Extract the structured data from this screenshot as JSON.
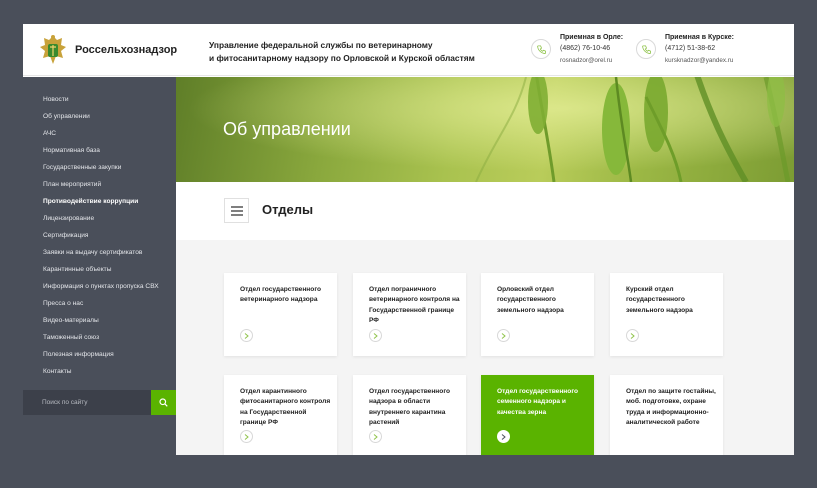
{
  "header": {
    "site_name": "Россельхознадзор",
    "org_title_line1": "Управление федеральной службы по ветеринарному",
    "org_title_line2": "и фитосанитарному надзору по Орловской и Курской областям",
    "contacts": [
      {
        "title": "Приемная в Орле:",
        "phone": "(4862) 76-10-46",
        "email": "rosnadzor@orel.ru"
      },
      {
        "title": "Приемная в Курске:",
        "phone": "(4712) 51-38-62",
        "email": "kursknadzor@yandex.ru"
      }
    ]
  },
  "sidebar": {
    "items": [
      {
        "label": "Новости"
      },
      {
        "label": "Об управлении"
      },
      {
        "label": "АЧС"
      },
      {
        "label": "Нормативная база"
      },
      {
        "label": "Государственные закупки"
      },
      {
        "label": "План мероприятий"
      },
      {
        "label": "Противодействие коррупции"
      },
      {
        "label": "Лицензирование"
      },
      {
        "label": "Сертификация"
      },
      {
        "label": "Заявки на выдачу сертификатов"
      },
      {
        "label": "Карантинные объекты"
      },
      {
        "label": "Информация о пунктах пропуска СВХ"
      },
      {
        "label": "Пресса о нас"
      },
      {
        "label": "Видео-материалы"
      },
      {
        "label": "Таможенный союз"
      },
      {
        "label": "Полезная информация"
      },
      {
        "label": "Контакты"
      }
    ],
    "active_index": 6,
    "search_placeholder": "Поиск по сайту"
  },
  "hero": {
    "title": "Об управлении"
  },
  "section": {
    "title": "Отделы"
  },
  "cards": [
    {
      "title": "Отдел государственного ветеринарного надзора"
    },
    {
      "title": "Отдел пограничного ветеринарного контроля на Государственной границе РФ"
    },
    {
      "title": "Орловский отдел государственного земельного надзора"
    },
    {
      "title": "Курский отдел государственного земельного надзора"
    },
    {
      "title": "Отдел карантинного фитосанитарного контроля на Государственной границе РФ"
    },
    {
      "title": "Отдел государственного надзора в области внутреннего карантина растений"
    },
    {
      "title": "Отдел государственного семенного надзора и качества зерна"
    },
    {
      "title": "Отдел по защите гостайны, моб. подготовке, охране труда и информационно-аналитической работе"
    }
  ],
  "colors": {
    "accent": "#5ab300",
    "sidebar": "#4a4f5a"
  },
  "icons": {
    "logo": "emblem-icon",
    "phone": "phone-icon",
    "search": "search-icon",
    "menu": "hamburger-icon",
    "arrow": "chevron-right-icon"
  }
}
